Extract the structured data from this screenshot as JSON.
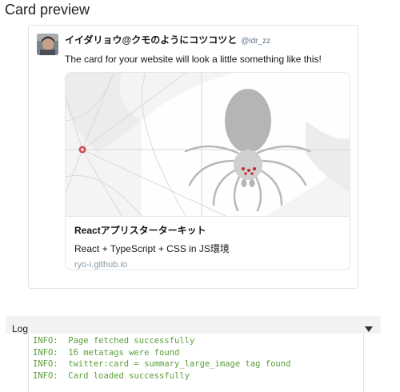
{
  "page": {
    "title": "Card preview"
  },
  "tweet": {
    "author_name": "イイダリョウ@クモのようにコツコツと",
    "author_handle": "@idr_zz",
    "text": "The card for your website will look a little something like this!"
  },
  "card": {
    "image_icon": "spider-illustration",
    "title": "Reactアプリスターターキット",
    "description": "React + TypeScript + CSS in JS環境",
    "domain": "ryo-i.github.io"
  },
  "log": {
    "title": "Log",
    "toggle_icon": "triangle-down-icon",
    "lines": [
      "INFO:  Page fetched successfully",
      "INFO:  16 metatags were found",
      "INFO:  twitter:card = summary_large_image tag found",
      "INFO:  Card loaded successfully"
    ]
  },
  "colors": {
    "log_text": "#5a9e3a",
    "muted_text": "#657786",
    "border": "#e1e8ed"
  }
}
